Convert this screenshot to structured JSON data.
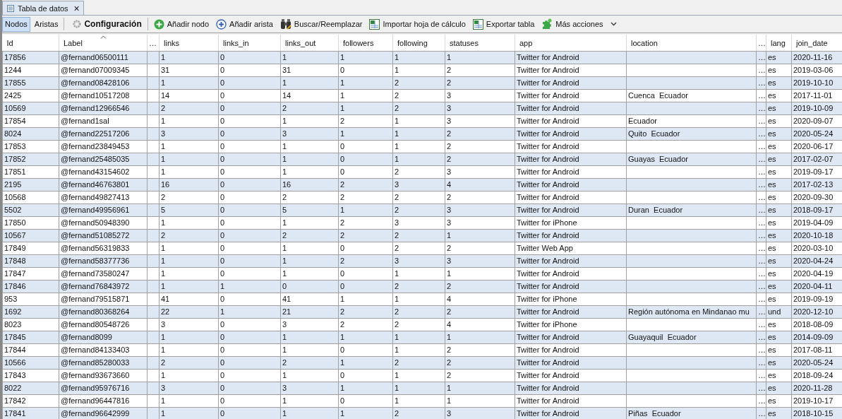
{
  "tab": {
    "title": "Tabla de datos",
    "close": "×"
  },
  "toolbar": {
    "views": [
      {
        "label": "Nodos",
        "selected": true
      },
      {
        "label": "Aristas",
        "selected": false
      }
    ],
    "actions": [
      {
        "kind": "gear",
        "label": "Configuración"
      },
      {
        "kind": "add-node",
        "label": "Añadir nodo"
      },
      {
        "kind": "add-edge",
        "label": "Añadir arista"
      },
      {
        "kind": "search",
        "label": "Buscar/Reemplazar"
      },
      {
        "kind": "import",
        "label": "Importar hoja de cálculo"
      },
      {
        "kind": "export",
        "label": "Exportar tabla"
      },
      {
        "kind": "more",
        "label": "Más acciones"
      }
    ]
  },
  "table": {
    "columns": [
      {
        "label": "Id",
        "sorted": false
      },
      {
        "label": "Label",
        "sorted": true
      },
      {
        "label": "…",
        "sorted": false
      },
      {
        "label": "links",
        "sorted": false
      },
      {
        "label": "links_in",
        "sorted": false
      },
      {
        "label": "links_out",
        "sorted": false
      },
      {
        "label": "followers",
        "sorted": false
      },
      {
        "label": "following",
        "sorted": false
      },
      {
        "label": "statuses",
        "sorted": false
      },
      {
        "label": "app",
        "sorted": false
      },
      {
        "label": "location",
        "sorted": false
      },
      {
        "label": "…",
        "sorted": false
      },
      {
        "label": "lang",
        "sorted": false
      },
      {
        "label": "join_date",
        "sorted": false
      }
    ],
    "rows": [
      {
        "id": "17856",
        "label": "@fernand06500111",
        "links": "1",
        "links_in": "0",
        "links_out": "1",
        "followers": "1",
        "following": "1",
        "statuses": "1",
        "app": "Twitter for Android",
        "more": "…",
        "lang": "es",
        "join_date": "2020-11-16"
      },
      {
        "id": "1244",
        "label": "@fernand07009345",
        "links": "31",
        "links_in": "0",
        "links_out": "31",
        "followers": "0",
        "following": "1",
        "statuses": "2",
        "app": "Twitter for Android",
        "more": "…",
        "lang": "es",
        "join_date": "2019-03-06"
      },
      {
        "id": "17855",
        "label": "@fernand08428106",
        "links": "1",
        "links_in": "0",
        "links_out": "1",
        "followers": "1",
        "following": "2",
        "statuses": "2",
        "app": "Twitter for Android",
        "more": "…",
        "lang": "es",
        "join_date": "2019-10-10"
      },
      {
        "id": "2425",
        "label": "@fernand10517208",
        "links": "14",
        "links_in": "0",
        "links_out": "14",
        "followers": "1",
        "following": "2",
        "statuses": "3",
        "app": "Twitter for Android",
        "location": "Cuenca  Ecuador",
        "more": "…",
        "lang": "es",
        "join_date": "2017-11-01"
      },
      {
        "id": "10569",
        "label": "@fernand12966546",
        "links": "2",
        "links_in": "0",
        "links_out": "2",
        "followers": "1",
        "following": "2",
        "statuses": "3",
        "app": "Twitter for Android",
        "more": "…",
        "lang": "es",
        "join_date": "2019-10-09"
      },
      {
        "id": "17854",
        "label": "@fernand1sal",
        "links": "1",
        "links_in": "0",
        "links_out": "1",
        "followers": "2",
        "following": "1",
        "statuses": "3",
        "app": "Twitter for Android",
        "location": "Ecuador",
        "more": "…",
        "lang": "es",
        "join_date": "2020-09-07"
      },
      {
        "id": "8024",
        "label": "@fernand22517206",
        "links": "3",
        "links_in": "0",
        "links_out": "3",
        "followers": "1",
        "following": "1",
        "statuses": "2",
        "app": "Twitter for Android",
        "location": "Quito  Ecuador",
        "more": "…",
        "lang": "es",
        "join_date": "2020-05-24"
      },
      {
        "id": "17853",
        "label": "@fernand23849453",
        "links": "1",
        "links_in": "0",
        "links_out": "1",
        "followers": "0",
        "following": "1",
        "statuses": "2",
        "app": "Twitter for Android",
        "more": "…",
        "lang": "es",
        "join_date": "2020-06-17"
      },
      {
        "id": "17852",
        "label": "@fernand25485035",
        "links": "1",
        "links_in": "0",
        "links_out": "1",
        "followers": "0",
        "following": "1",
        "statuses": "2",
        "app": "Twitter for Android",
        "location": "Guayas  Ecuador",
        "more": "…",
        "lang": "es",
        "join_date": "2017-02-07"
      },
      {
        "id": "17851",
        "label": "@fernand43154602",
        "links": "1",
        "links_in": "0",
        "links_out": "1",
        "followers": "0",
        "following": "2",
        "statuses": "3",
        "app": "Twitter for Android",
        "more": "…",
        "lang": "es",
        "join_date": "2019-09-17"
      },
      {
        "id": "2195",
        "label": "@fernand46763801",
        "links": "16",
        "links_in": "0",
        "links_out": "16",
        "followers": "2",
        "following": "3",
        "statuses": "4",
        "app": "Twitter for Android",
        "more": "…",
        "lang": "es",
        "join_date": "2017-02-13"
      },
      {
        "id": "10568",
        "label": "@fernand49827413",
        "links": "2",
        "links_in": "0",
        "links_out": "2",
        "followers": "2",
        "following": "2",
        "statuses": "2",
        "app": "Twitter for Android",
        "more": "…",
        "lang": "es",
        "join_date": "2020-09-30"
      },
      {
        "id": "5502",
        "label": "@fernand49956961",
        "links": "5",
        "links_in": "0",
        "links_out": "5",
        "followers": "1",
        "following": "2",
        "statuses": "3",
        "app": "Twitter for Android",
        "location": "Duran  Ecuador",
        "more": "…",
        "lang": "es",
        "join_date": "2018-09-17"
      },
      {
        "id": "17850",
        "label": "@fernand50948390",
        "links": "1",
        "links_in": "0",
        "links_out": "1",
        "followers": "2",
        "following": "3",
        "statuses": "3",
        "app": "Twitter for iPhone",
        "more": "…",
        "lang": "es",
        "join_date": "2019-04-09"
      },
      {
        "id": "10567",
        "label": "@fernand51085272",
        "links": "2",
        "links_in": "0",
        "links_out": "2",
        "followers": "2",
        "following": "2",
        "statuses": "1",
        "app": "Twitter for Android",
        "more": "…",
        "lang": "es",
        "join_date": "2020-10-18"
      },
      {
        "id": "17849",
        "label": "@fernand56319833",
        "links": "1",
        "links_in": "0",
        "links_out": "1",
        "followers": "0",
        "following": "2",
        "statuses": "2",
        "app": "Twitter Web App",
        "more": "…",
        "lang": "es",
        "join_date": "2020-03-10"
      },
      {
        "id": "17848",
        "label": "@fernand58377736",
        "links": "1",
        "links_in": "0",
        "links_out": "1",
        "followers": "2",
        "following": "3",
        "statuses": "3",
        "app": "Twitter for Android",
        "more": "…",
        "lang": "es",
        "join_date": "2020-04-24"
      },
      {
        "id": "17847",
        "label": "@fernand73580247",
        "links": "1",
        "links_in": "0",
        "links_out": "1",
        "followers": "0",
        "following": "1",
        "statuses": "1",
        "app": "Twitter for Android",
        "more": "…",
        "lang": "es",
        "join_date": "2020-04-19"
      },
      {
        "id": "17846",
        "label": "@fernand76843972",
        "links": "1",
        "links_in": "1",
        "links_out": "0",
        "followers": "0",
        "following": "2",
        "statuses": "2",
        "app": "Twitter for Android",
        "more": "…",
        "lang": "es",
        "join_date": "2020-04-11"
      },
      {
        "id": "953",
        "label": "@fernand79515871",
        "links": "41",
        "links_in": "0",
        "links_out": "41",
        "followers": "1",
        "following": "1",
        "statuses": "4",
        "app": "Twitter for iPhone",
        "more": "…",
        "lang": "es",
        "join_date": "2019-09-19"
      },
      {
        "id": "1692",
        "label": "@fernand80368264",
        "links": "22",
        "links_in": "1",
        "links_out": "21",
        "followers": "2",
        "following": "2",
        "statuses": "2",
        "app": "Twitter for Android",
        "location": "Región autónoma en Mindanao mu",
        "more": "…",
        "lang": "und",
        "join_date": "2020-12-10"
      },
      {
        "id": "8023",
        "label": "@fernand80548726",
        "links": "3",
        "links_in": "0",
        "links_out": "3",
        "followers": "2",
        "following": "2",
        "statuses": "4",
        "app": "Twitter for iPhone",
        "more": "…",
        "lang": "es",
        "join_date": "2018-08-09"
      },
      {
        "id": "17845",
        "label": "@fernand8099",
        "links": "1",
        "links_in": "0",
        "links_out": "1",
        "followers": "1",
        "following": "1",
        "statuses": "1",
        "app": "Twitter for Android",
        "location": "Guayaquil  Ecuador",
        "more": "…",
        "lang": "es",
        "join_date": "2014-09-09"
      },
      {
        "id": "17844",
        "label": "@fernand84133403",
        "links": "1",
        "links_in": "0",
        "links_out": "1",
        "followers": "0",
        "following": "1",
        "statuses": "2",
        "app": "Twitter for Android",
        "more": "…",
        "lang": "es",
        "join_date": "2017-08-11"
      },
      {
        "id": "10566",
        "label": "@fernand85280033",
        "links": "2",
        "links_in": "0",
        "links_out": "2",
        "followers": "1",
        "following": "2",
        "statuses": "2",
        "app": "Twitter for Android",
        "more": "…",
        "lang": "es",
        "join_date": "2020-05-24"
      },
      {
        "id": "17843",
        "label": "@fernand93673660",
        "links": "1",
        "links_in": "0",
        "links_out": "1",
        "followers": "0",
        "following": "1",
        "statuses": "2",
        "app": "Twitter for Android",
        "more": "…",
        "lang": "es",
        "join_date": "2018-09-24"
      },
      {
        "id": "8022",
        "label": "@fernand95976716",
        "links": "3",
        "links_in": "0",
        "links_out": "3",
        "followers": "1",
        "following": "1",
        "statuses": "1",
        "app": "Twitter for Android",
        "more": "…",
        "lang": "es",
        "join_date": "2020-11-28"
      },
      {
        "id": "17842",
        "label": "@fernand96447816",
        "links": "1",
        "links_in": "0",
        "links_out": "1",
        "followers": "0",
        "following": "1",
        "statuses": "1",
        "app": "Twitter for Android",
        "more": "…",
        "lang": "es",
        "join_date": "2019-10-17"
      },
      {
        "id": "17841",
        "label": "@fernand96642999",
        "links": "1",
        "links_in": "0",
        "links_out": "1",
        "followers": "1",
        "following": "2",
        "statuses": "3",
        "app": "Twitter for Android",
        "location": "Piñas  Ecuador",
        "more": "…",
        "lang": "es",
        "join_date": "2018-10-15"
      }
    ]
  }
}
